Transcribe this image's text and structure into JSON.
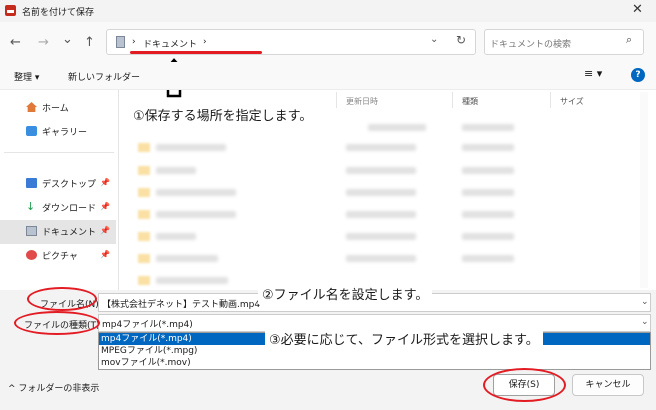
{
  "window": {
    "title": "名前を付けて保存",
    "close_glyph": "✕"
  },
  "nav": {
    "back": "←",
    "forward": "→",
    "recent": "⌄",
    "up": "↑"
  },
  "address": {
    "sep1": "›",
    "crumb": "ドキュメント",
    "sep2": "›",
    "dropdown": "⌄",
    "refresh": "↻"
  },
  "search": {
    "placeholder": "ドキュメントの検索",
    "icon": "⌕"
  },
  "toolbar": {
    "organize": "整理 ▾",
    "new_folder": "新しいフォルダー",
    "view": "≡ ▾",
    "help": "?"
  },
  "sidebar": {
    "items": [
      {
        "label": "ホーム",
        "icon": "home-icon"
      },
      {
        "label": "ギャラリー",
        "icon": "gallery-icon"
      },
      {
        "label": "デスクトップ",
        "icon": "desktop-icon",
        "pin": "📌"
      },
      {
        "label": "ダウンロード",
        "icon": "download-icon",
        "pin": "📌"
      },
      {
        "label": "ドキュメント",
        "icon": "document-icon",
        "pin": "📌",
        "selected": true
      },
      {
        "label": "ピクチャ",
        "icon": "pictures-icon",
        "pin": "📌"
      }
    ]
  },
  "columns": {
    "modified": "更新日時",
    "type": "種類",
    "size": "サイズ"
  },
  "annotations": {
    "step1": "①保存する場所を指定します。",
    "step2": "②ファイル名を設定します。",
    "step3": "③必要に応じて、ファイル形式を選択します。"
  },
  "form": {
    "filename_label": "ファイル名(N):",
    "filename_value": "【株式会社デネット】テスト動画.mp4",
    "filetype_label": "ファイルの種類(T):",
    "filetype_value": "mp4ファイル(*.mp4)",
    "filetype_options": [
      "mp4ファイル(*.mp4)",
      "MPEGファイル(*.mpg)",
      "movファイル(*.mov)"
    ]
  },
  "footer": {
    "hide_folders": "フォルダーの非表示",
    "save": "保存(S)",
    "cancel": "キャンセル"
  },
  "colors": {
    "accent": "#0067c0",
    "annotation_red": "#e31b23",
    "folder": "#f6c85b"
  }
}
